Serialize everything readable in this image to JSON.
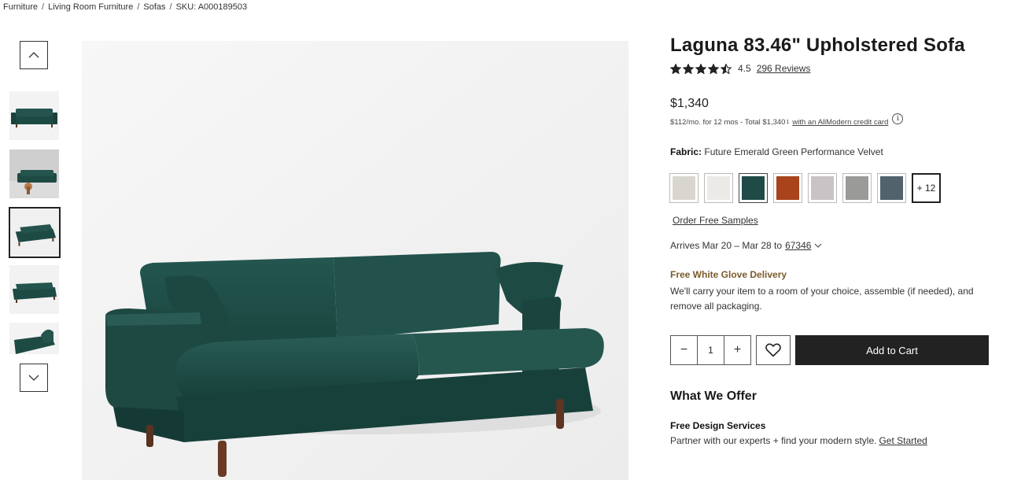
{
  "breadcrumb": {
    "items": [
      "Furniture",
      "Living Room Furniture",
      "Sofas",
      "SKU: A000189503"
    ],
    "separator": "/"
  },
  "gallery": {
    "up_icon": "chevron-up-icon",
    "down_icon": "chevron-down-icon",
    "thumbnails": [
      {
        "name": "thumbnail-front",
        "active": false
      },
      {
        "name": "thumbnail-room",
        "active": false
      },
      {
        "name": "thumbnail-angle",
        "active": true
      },
      {
        "name": "thumbnail-side",
        "active": false
      },
      {
        "name": "thumbnail-detail",
        "active": false
      }
    ],
    "sofa_color": "#1e4a44"
  },
  "product": {
    "title": "Laguna 83.46\" Upholstered Sofa",
    "rating": "4.5",
    "rating_value": 4.5,
    "rating_max": 5,
    "reviews": "296 Reviews",
    "price": "$1,340",
    "financing": "$112/mo. for 12 mos - Total $1,340",
    "financing_sup": "1",
    "financing_link": "with an AllModern credit card",
    "fabric_label": "Fabric:",
    "fabric_value": "Future Emerald Green Performance Velvet",
    "swatches": [
      {
        "color": "#d9d6cf",
        "selected": false
      },
      {
        "color": "#eceae6",
        "selected": false
      },
      {
        "color": "#1f4a46",
        "selected": true
      },
      {
        "color": "#a8431c",
        "selected": false
      },
      {
        "color": "#c9c3c6",
        "selected": false
      },
      {
        "color": "#9a9a98",
        "selected": false
      },
      {
        "color": "#52626c",
        "selected": false
      }
    ],
    "more_swatches": "+ 12",
    "order_samples": "Order Free Samples",
    "arrives_text": "Arrives Mar 20 – Mar 28 to",
    "zip": "67346",
    "delivery_title": "Free White Glove Delivery",
    "delivery_text": "We'll carry your item to a room of your choice, assemble (if needed), and remove all packaging.",
    "quantity": "1",
    "minus": "−",
    "plus": "+",
    "add_to_cart": "Add to Cart"
  },
  "offer": {
    "title": "What We Offer",
    "design_title": "Free Design Services",
    "design_text": "Partner with our experts + find your modern style.",
    "design_link": "Get Started"
  },
  "colors": {
    "delivery_accent": "#7a5a2a",
    "cart_button": "#222222",
    "star": "#222222"
  }
}
